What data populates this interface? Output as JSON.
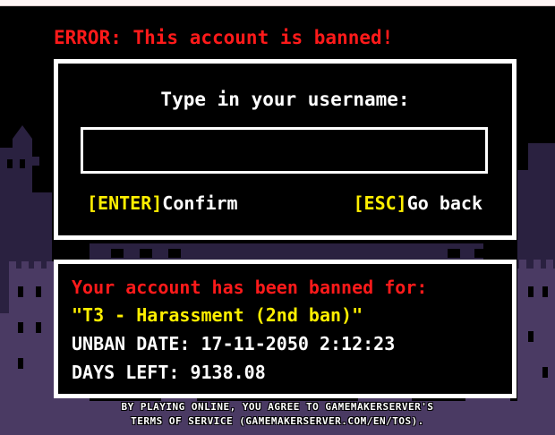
{
  "error_message": "ERROR: This account is banned!",
  "login": {
    "prompt": "Type in your username:",
    "input_value": "",
    "confirm_key": "[ENTER]",
    "confirm_label": "Confirm",
    "back_key": "[ESC]",
    "back_label": "Go back"
  },
  "ban": {
    "title": "Your account has been banned for:",
    "reason": "\"T3 - Harassment (2nd ban)\"",
    "unban_date": "UNBAN DATE: 17-11-2050 2:12:23",
    "days_left": "DAYS LEFT: 9138.08"
  },
  "footer": {
    "tos_line1": "BY PLAYING ONLINE, YOU AGREE TO GAMEMAKERSERVER'S",
    "tos_line2": "TERMS OF SERVICE (GAMEMAKERSERVER.COM/EN/TOS)."
  },
  "colors": {
    "error_red": "#ff1a1a",
    "key_yellow": "#ffef00",
    "castle_purple": "#4a3a63",
    "castle_dark": "#2a2140"
  }
}
